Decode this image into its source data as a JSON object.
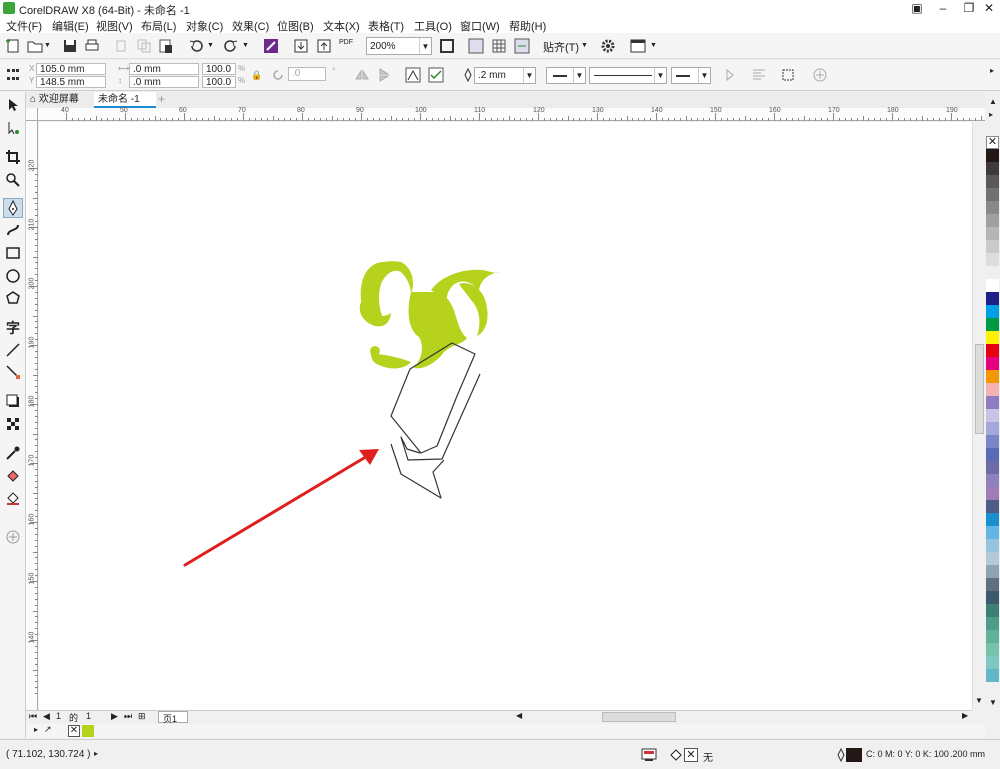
{
  "window": {
    "title": "CorelDRAW X8 (64-Bit) - 未命名 -1"
  },
  "menu": [
    "文件(F)",
    "编辑(E)",
    "视图(V)",
    "布局(L)",
    "对象(C)",
    "效果(C)",
    "位图(B)",
    "文本(X)",
    "表格(T)",
    "工具(O)",
    "窗口(W)",
    "帮助(H)"
  ],
  "toolbar": {
    "zoom": "200%",
    "snap_label": "贴齐(T)",
    "pdf_label": "PDF"
  },
  "property_bar": {
    "x": "105.0 mm",
    "y": "148.5 mm",
    "width": ".0 mm",
    "height": ".0 mm",
    "scale_w": "100.0",
    "scale_h": "100.0",
    "pct": "%",
    "angle": ".0",
    "outline_width": ".2 mm"
  },
  "tabs": [
    {
      "label": "欢迎屏幕"
    },
    {
      "label": "未命名 -1"
    }
  ],
  "rulers": {
    "h_labels": [
      "40",
      "50",
      "60",
      "70",
      "80",
      "90",
      "100",
      "110",
      "120",
      "130",
      "140",
      "150",
      "160",
      "170",
      "180",
      "190"
    ],
    "v_labels": [
      "220",
      "210",
      "200",
      "190",
      "180",
      "170",
      "160",
      "150",
      "140"
    ]
  },
  "page_nav": {
    "current": "1",
    "of": "的",
    "total": "1",
    "page_tab": "页1"
  },
  "status": {
    "coords": "( 71.102, 130.724 )",
    "fill_none": "无",
    "outline_color": "C: 0 M: 0 Y: 0 K: 100",
    "outline_width": ".200 mm"
  },
  "colors": {
    "accent_green": "#b6d21c",
    "arrow_red": "#e01e1e",
    "outline": "#333333",
    "palette": [
      "#231815",
      "#3e3a39",
      "#595757",
      "#727171",
      "#898989",
      "#9fa0a0",
      "#b5b5b6",
      "#c9caca",
      "#dcdddd",
      "#efefef",
      "#ffffff",
      "#1d2088",
      "#00a0e9",
      "#009944",
      "#fff100",
      "#e60012",
      "#e4007f",
      "#f39800",
      "#f5b2b2",
      "#8e7cc3",
      "#c9c3e6",
      "#a3a7d9",
      "#7b86c8",
      "#5a6bb6",
      "#6d6ca7",
      "#8f82bc",
      "#a17db7",
      "#4f5a87",
      "#1b8fce",
      "#63b5e5",
      "#96c4dc",
      "#b2c9d9",
      "#8da4b5",
      "#607080",
      "#3d5a6c",
      "#3c7f74",
      "#4e9c87",
      "#5fb19a",
      "#78c2ad",
      "#80c7bf",
      "#62b7c8"
    ]
  }
}
